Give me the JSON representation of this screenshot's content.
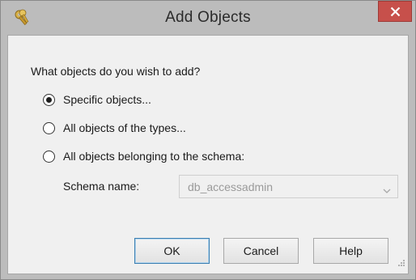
{
  "window": {
    "title": "Add Objects",
    "title_icon": "keys-icon",
    "close_icon": "close-icon"
  },
  "prompt": "What objects do you wish to add?",
  "options": [
    {
      "label": "Specific objects...",
      "checked": true
    },
    {
      "label": "All objects of the types...",
      "checked": false
    },
    {
      "label": "All objects belonging to the schema:",
      "checked": false
    }
  ],
  "schema": {
    "label": "Schema name:",
    "value": "db_accessadmin",
    "enabled": false
  },
  "buttons": {
    "ok": "OK",
    "cancel": "Cancel",
    "help": "Help"
  },
  "colors": {
    "titlebar": "#bcbcbc",
    "close_button": "#c7504b",
    "dialog_background": "#f0f0f0",
    "default_button_border": "#3c7fb1"
  }
}
